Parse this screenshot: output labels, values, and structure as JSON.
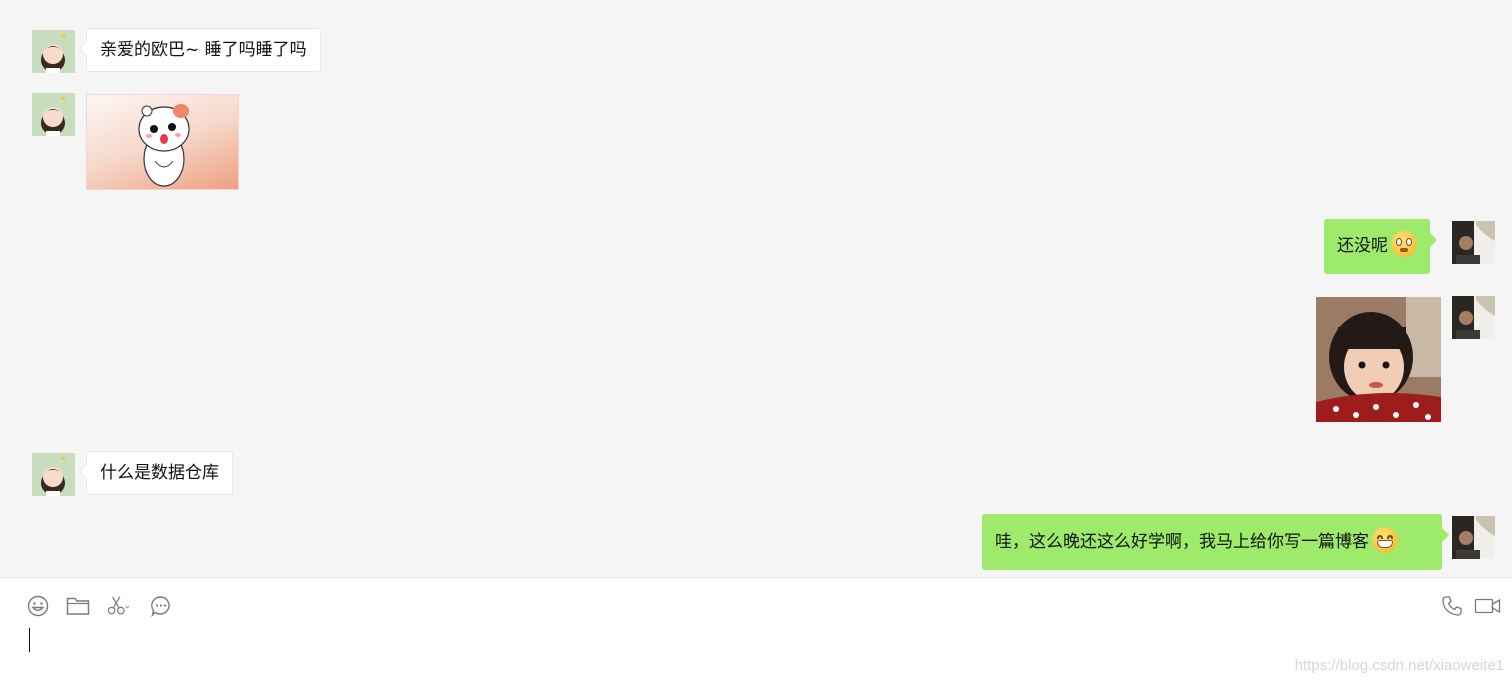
{
  "messages": [
    {
      "side": "left",
      "type": "text",
      "text": "亲爱的欧巴~ 睡了吗睡了吗"
    },
    {
      "side": "left",
      "type": "sticker",
      "sticker_name": "hamster-sticker"
    },
    {
      "side": "right",
      "type": "text",
      "text": "还没呢",
      "emoji": "rolling-eyes-emoji"
    },
    {
      "side": "right",
      "type": "image",
      "image_name": "girl-photo"
    },
    {
      "side": "left",
      "type": "text",
      "text": "什么是数据仓库"
    },
    {
      "side": "right",
      "type": "text",
      "text": "哇，这么晚还这么好学啊，我马上给你写一篇博客",
      "emoji": "grin-emoji"
    }
  ],
  "toolbar": {
    "left_icons": [
      "emoji-icon",
      "folder-icon",
      "scissors-icon",
      "chat-history-icon"
    ],
    "right_icons": [
      "phone-icon",
      "video-call-icon"
    ]
  },
  "watermark": "https://blog.csdn.net/xiaoweite1",
  "colors": {
    "chat_bg": "#f5f5f5",
    "sent_bubble": "#9eea6a",
    "received_bubble": "#ffffff",
    "input_bg": "#ffffff"
  }
}
